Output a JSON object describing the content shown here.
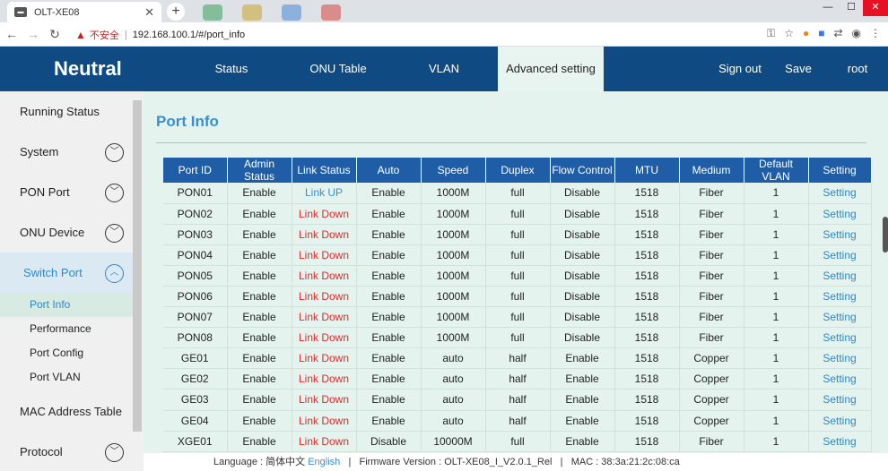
{
  "browser": {
    "tab_title": "OLT-XE08",
    "tab_close": "✕",
    "new_tab": "+",
    "security_label": "不安全",
    "url": "192.168.100.1/#/port_info",
    "minimize": "—",
    "maximize": "☐",
    "close": "✕"
  },
  "header": {
    "brand": "Neutral",
    "nav": [
      "Status",
      "ONU Table",
      "VLAN",
      "Advanced setting"
    ],
    "sign_out": "Sign out",
    "save": "Save",
    "user": "root"
  },
  "sidebar": {
    "items": [
      {
        "label": "Running Status"
      },
      {
        "label": "System"
      },
      {
        "label": "PON Port"
      },
      {
        "label": "ONU Device"
      },
      {
        "label": "Switch Port"
      },
      {
        "label": "MAC Address Table"
      },
      {
        "label": "Protocol"
      }
    ],
    "sub_items": [
      "Port Info",
      "Performance",
      "Port Config",
      "Port VLAN"
    ]
  },
  "main": {
    "title": "Port Info",
    "columns": [
      "Port ID",
      "Admin Status",
      "Link Status",
      "Auto",
      "Speed",
      "Duplex",
      "Flow Control",
      "MTU",
      "Medium",
      "Default VLAN",
      "Setting"
    ],
    "rows": [
      [
        "PON01",
        "Enable",
        "Link UP",
        "Enable",
        "1000M",
        "full",
        "Disable",
        "1518",
        "Fiber",
        "1",
        "Setting"
      ],
      [
        "PON02",
        "Enable",
        "Link Down",
        "Enable",
        "1000M",
        "full",
        "Disable",
        "1518",
        "Fiber",
        "1",
        "Setting"
      ],
      [
        "PON03",
        "Enable",
        "Link Down",
        "Enable",
        "1000M",
        "full",
        "Disable",
        "1518",
        "Fiber",
        "1",
        "Setting"
      ],
      [
        "PON04",
        "Enable",
        "Link Down",
        "Enable",
        "1000M",
        "full",
        "Disable",
        "1518",
        "Fiber",
        "1",
        "Setting"
      ],
      [
        "PON05",
        "Enable",
        "Link Down",
        "Enable",
        "1000M",
        "full",
        "Disable",
        "1518",
        "Fiber",
        "1",
        "Setting"
      ],
      [
        "PON06",
        "Enable",
        "Link Down",
        "Enable",
        "1000M",
        "full",
        "Disable",
        "1518",
        "Fiber",
        "1",
        "Setting"
      ],
      [
        "PON07",
        "Enable",
        "Link Down",
        "Enable",
        "1000M",
        "full",
        "Disable",
        "1518",
        "Fiber",
        "1",
        "Setting"
      ],
      [
        "PON08",
        "Enable",
        "Link Down",
        "Enable",
        "1000M",
        "full",
        "Disable",
        "1518",
        "Fiber",
        "1",
        "Setting"
      ],
      [
        "GE01",
        "Enable",
        "Link Down",
        "Enable",
        "auto",
        "half",
        "Enable",
        "1518",
        "Copper",
        "1",
        "Setting"
      ],
      [
        "GE02",
        "Enable",
        "Link Down",
        "Enable",
        "auto",
        "half",
        "Enable",
        "1518",
        "Copper",
        "1",
        "Setting"
      ],
      [
        "GE03",
        "Enable",
        "Link Down",
        "Enable",
        "auto",
        "half",
        "Enable",
        "1518",
        "Copper",
        "1",
        "Setting"
      ],
      [
        "GE04",
        "Enable",
        "Link Down",
        "Enable",
        "auto",
        "half",
        "Enable",
        "1518",
        "Copper",
        "1",
        "Setting"
      ],
      [
        "XGE01",
        "Enable",
        "Link Down",
        "Disable",
        "10000M",
        "full",
        "Enable",
        "1518",
        "Fiber",
        "1",
        "Setting"
      ]
    ]
  },
  "footer": {
    "language_label": "Language : 简体中文",
    "language_en": "English",
    "divider": "|",
    "firmware": "Firmware Version : OLT-XE08_I_V2.0.1_Rel",
    "mac": "MAC : 38:3a:21:2c:08:ca"
  },
  "colors": {
    "header_bg": "#0f4a82",
    "table_header": "#1f5da6",
    "link_up": "#3b8ed0",
    "link_down": "#e02a2a"
  }
}
